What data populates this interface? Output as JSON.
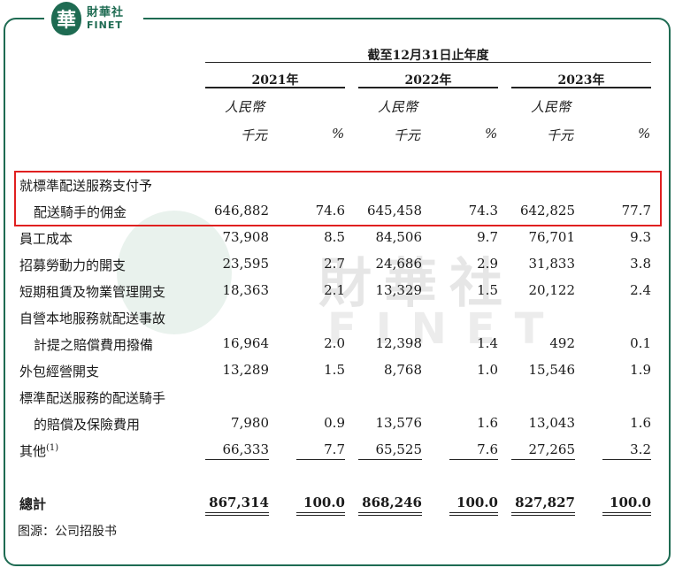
{
  "brand": {
    "mark": "華",
    "name_cn": "財華社",
    "name_en": "FINET"
  },
  "watermark": {
    "mark": "華",
    "cn": "財華社",
    "en": "FINET"
  },
  "table": {
    "period_header": "截至12月31日止年度",
    "years": [
      "2021年",
      "2022年",
      "2023年"
    ],
    "currency": "人民幣",
    "unit": "千元",
    "pct": "%",
    "rows": [
      {
        "label": [
          "就標準配送服務支付予",
          "配送騎手的佣金"
        ],
        "values": [
          "646,882",
          "74.6",
          "645,458",
          "74.3",
          "642,825",
          "77.7"
        ]
      },
      {
        "label": [
          "員工成本"
        ],
        "values": [
          "73,908",
          "8.5",
          "84,506",
          "9.7",
          "76,701",
          "9.3"
        ]
      },
      {
        "label": [
          "招募勞動力的開支"
        ],
        "values": [
          "23,595",
          "2.7",
          "24,686",
          "2.9",
          "31,833",
          "3.8"
        ]
      },
      {
        "label": [
          "短期租賃及物業管理開支"
        ],
        "values": [
          "18,363",
          "2.1",
          "13,329",
          "1.5",
          "20,122",
          "2.4"
        ]
      },
      {
        "label": [
          "自營本地服務就配送事故",
          "計提之賠償費用撥備"
        ],
        "values": [
          "16,964",
          "2.0",
          "12,398",
          "1.4",
          "492",
          "0.1"
        ]
      },
      {
        "label": [
          "外包經營開支"
        ],
        "values": [
          "13,289",
          "1.5",
          "8,768",
          "1.0",
          "15,546",
          "1.9"
        ]
      },
      {
        "label": [
          "標準配送服務的配送騎手",
          "的賠償及保險費用"
        ],
        "values": [
          "7,980",
          "0.9",
          "13,576",
          "1.6",
          "13,043",
          "1.6"
        ]
      },
      {
        "label": [
          "其他"
        ],
        "note": "(1)",
        "values": [
          "66,333",
          "7.7",
          "65,525",
          "7.6",
          "27,265",
          "3.2"
        ]
      }
    ],
    "total": {
      "label": "總計",
      "values": [
        "867,314",
        "100.0",
        "868,246",
        "100.0",
        "827,827",
        "100.0"
      ]
    }
  },
  "source": "图源：公司招股书"
}
